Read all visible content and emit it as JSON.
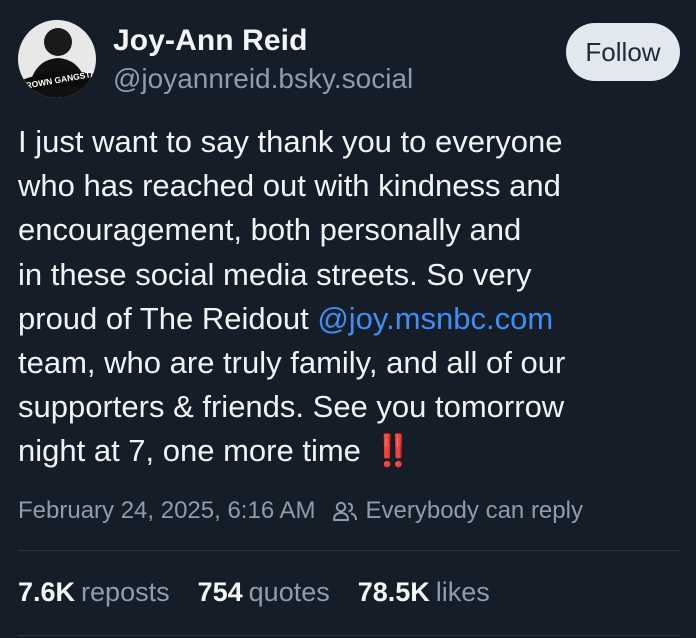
{
  "author": {
    "display_name": "Joy-Ann Reid",
    "handle": "@joyannreid.bsky.social",
    "avatar_text": "GROWN GANGSTA"
  },
  "follow_button": {
    "label": "Follow"
  },
  "post": {
    "lines": [
      "I just want to say thank you to everyone",
      "who has reached out with kindness and",
      "encouragement, both personally and",
      "in these social media streets. So very",
      "proud of The Reidout ",
      "team, who are truly family, and all of our",
      "supporters & friends. See you tomorrow",
      "night at 7, one more time "
    ],
    "mention": "@joy.msnbc.com",
    "emoji": "‼️"
  },
  "meta": {
    "timestamp": "February 24, 2025, 6:16 AM",
    "reply_setting": "Everybody can reply",
    "reply_icon": "people-icon"
  },
  "stats": {
    "reposts_count": "7.6K",
    "reposts_label": "reposts",
    "quotes_count": "754",
    "quotes_label": "quotes",
    "likes_count": "78.5K",
    "likes_label": "likes"
  },
  "colors": {
    "background": "#151d28",
    "text": "#f1f3f5",
    "muted": "#8e9cad",
    "link": "#3d8ff5",
    "button_bg": "#e3e8ef"
  }
}
